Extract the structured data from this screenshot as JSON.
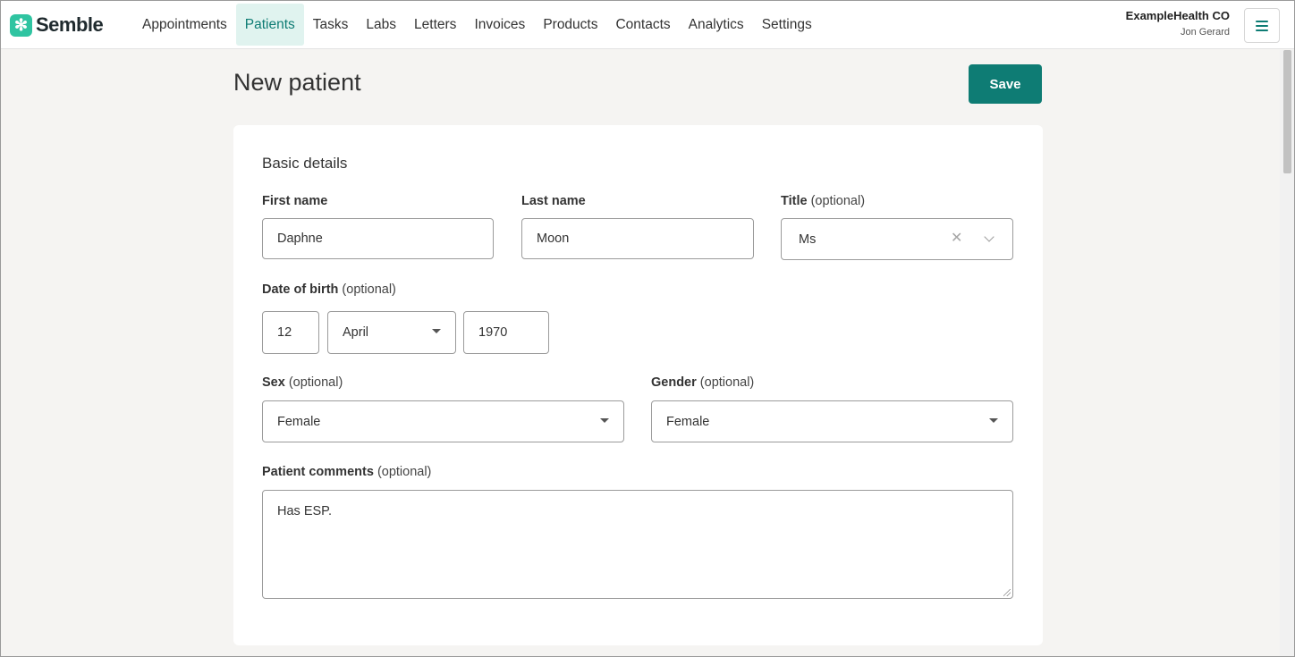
{
  "app": {
    "brand": "Semble",
    "accent": "#0e7c74",
    "logo_mark_color": "#2fc4a1"
  },
  "nav": {
    "items": [
      {
        "label": "Appointments",
        "active": false
      },
      {
        "label": "Patients",
        "active": true
      },
      {
        "label": "Tasks",
        "active": false
      },
      {
        "label": "Labs",
        "active": false
      },
      {
        "label": "Letters",
        "active": false
      },
      {
        "label": "Invoices",
        "active": false
      },
      {
        "label": "Products",
        "active": false
      },
      {
        "label": "Contacts",
        "active": false
      },
      {
        "label": "Analytics",
        "active": false
      },
      {
        "label": "Settings",
        "active": false
      }
    ]
  },
  "account": {
    "org": "ExampleHealth CO",
    "user": "Jon Gerard",
    "menu_icon": "hamburger-icon"
  },
  "page": {
    "title": "New patient",
    "save_label": "Save"
  },
  "form": {
    "section_title": "Basic details",
    "optional_text": "(optional)",
    "first_name": {
      "label": "First name",
      "value": "Daphne"
    },
    "last_name": {
      "label": "Last name",
      "value": "Moon"
    },
    "title": {
      "label": "Title",
      "value": "Ms"
    },
    "dob": {
      "label": "Date of birth",
      "day": "12",
      "month": "April",
      "year": "1970"
    },
    "sex": {
      "label": "Sex",
      "value": "Female"
    },
    "gender": {
      "label": "Gender",
      "value": "Female"
    },
    "comments": {
      "label": "Patient comments",
      "value": "Has ESP."
    }
  }
}
